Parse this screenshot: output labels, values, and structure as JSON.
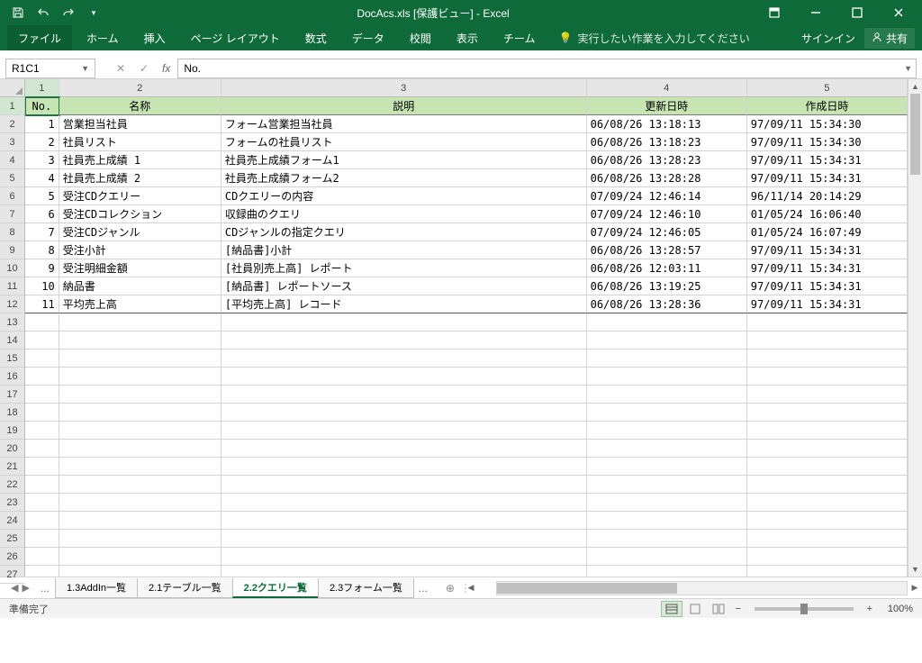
{
  "title": "DocAcs.xls  [保護ビュー] - Excel",
  "ribbon": {
    "file": "ファイル",
    "home": "ホーム",
    "insert": "挿入",
    "layout": "ページ レイアウト",
    "formulas": "数式",
    "data": "データ",
    "review": "校閲",
    "view": "表示",
    "team": "チーム",
    "tellme": "実行したい作業を入力してください",
    "signin": "サインイン",
    "share": "共有"
  },
  "namebox": "R1C1",
  "formula": "No.",
  "col_headers": [
    "1",
    "2",
    "3",
    "4",
    "5"
  ],
  "table_headers": {
    "no": "No.",
    "name": "名称",
    "desc": "説明",
    "updated": "更新日時",
    "created": "作成日時"
  },
  "rows": [
    {
      "no": "1",
      "name": "営業担当社員",
      "desc": "フォーム営業担当社員",
      "updated": "06/08/26 13:18:13",
      "created": "97/09/11 15:34:30"
    },
    {
      "no": "2",
      "name": "社員リスト",
      "desc": "フォームの社員リスト",
      "updated": "06/08/26 13:18:23",
      "created": "97/09/11 15:34:30"
    },
    {
      "no": "3",
      "name": "社員売上成績 1",
      "desc": "社員売上成績フォーム1",
      "updated": "06/08/26 13:28:23",
      "created": "97/09/11 15:34:31"
    },
    {
      "no": "4",
      "name": "社員売上成績 2",
      "desc": "社員売上成績フォーム2",
      "updated": "06/08/26 13:28:28",
      "created": "97/09/11 15:34:31"
    },
    {
      "no": "5",
      "name": "受注CDクエリー",
      "desc": "CDクエリーの内容",
      "updated": "07/09/24 12:46:14",
      "created": "96/11/14 20:14:29"
    },
    {
      "no": "6",
      "name": "受注CDコレクション",
      "desc": "収録曲のクエリ",
      "updated": "07/09/24 12:46:10",
      "created": "01/05/24 16:06:40"
    },
    {
      "no": "7",
      "name": "受注CDジャンル",
      "desc": "CDジャンルの指定クエリ",
      "updated": "07/09/24 12:46:05",
      "created": "01/05/24 16:07:49"
    },
    {
      "no": "8",
      "name": "受注小計",
      "desc": "[納品書]小計",
      "updated": "06/08/26 13:28:57",
      "created": "97/09/11 15:34:31"
    },
    {
      "no": "9",
      "name": "受注明細金額",
      "desc": "[社員別売上高] レポート",
      "updated": "06/08/26 12:03:11",
      "created": "97/09/11 15:34:31"
    },
    {
      "no": "10",
      "name": "納品書",
      "desc": "[納品書] レポートソース",
      "updated": "06/08/26 13:19:25",
      "created": "97/09/11 15:34:31"
    },
    {
      "no": "11",
      "name": "平均売上高",
      "desc": "[平均売上高] レコード",
      "updated": "06/08/26 13:28:36",
      "created": "97/09/11 15:34:31"
    }
  ],
  "sheet_tabs": {
    "t1": "1.3AddIn一覧",
    "t2": "2.1テーブル一覧",
    "t3": "2.2クエリ一覧",
    "t4": "2.3フォーム一覧"
  },
  "status": {
    "ready": "準備完了",
    "zoom": "100%"
  }
}
